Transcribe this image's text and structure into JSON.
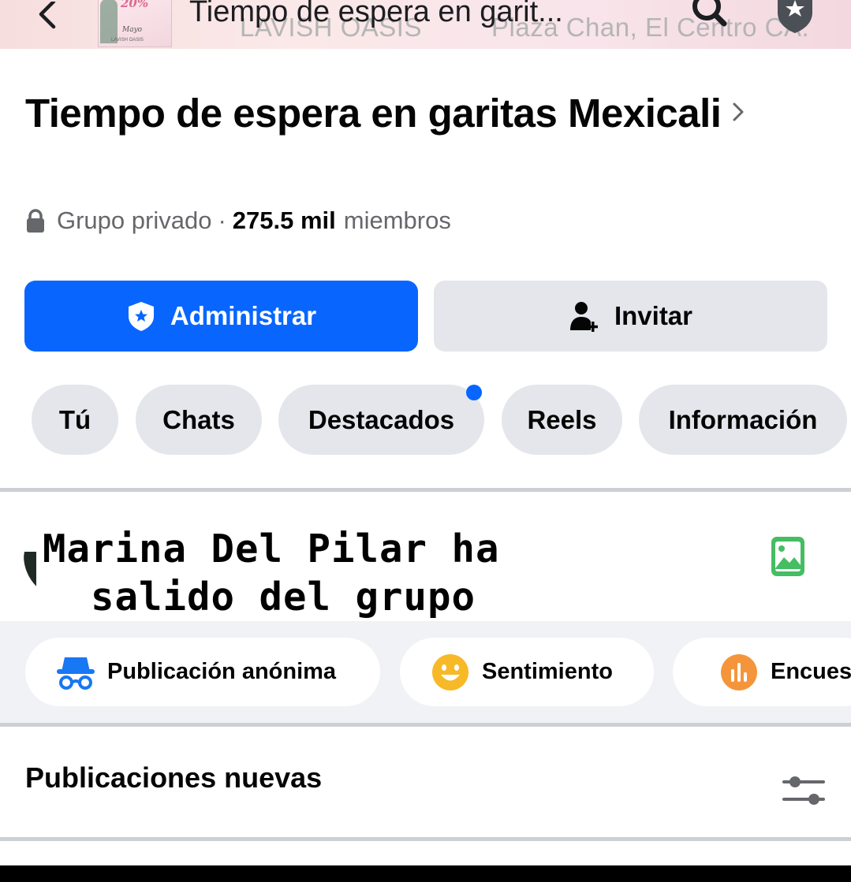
{
  "topbar": {
    "title": "Tiempo de espera en garit...",
    "cover_text_left": "LAVISH OASIS",
    "cover_text_right": "Plaza Chan, El Centro CA.",
    "thumb_percent": "20%",
    "thumb_caption": "Mayo",
    "thumb_footer": "LAVISH OASIS",
    "icons": {
      "back": "chevron-left-icon",
      "search": "search-icon",
      "star": "admin-badge-star-icon"
    },
    "background_color": "#f7dede"
  },
  "group": {
    "name": "Tiempo de espera en garitas Mexicali",
    "privacy": "Grupo privado",
    "separator": "·",
    "member_count": "275.5 mil",
    "member_label": "miembros"
  },
  "actions": {
    "manage_label": "Administrar",
    "invite_label": "Invitar",
    "accent_color": "#0866ff"
  },
  "tabs": [
    {
      "label": "Tú"
    },
    {
      "label": "Chats"
    },
    {
      "label": "Destacados",
      "has_notification_dot": true
    },
    {
      "label": "Reels"
    },
    {
      "label": "Información"
    }
  ],
  "composer": {
    "overlay_line_1": "Marina Del Pilar ha",
    "overlay_line_2": "salido del grupo",
    "photo_icon": "photo-icon",
    "photo_icon_color": "#45bd62"
  },
  "post_types": [
    {
      "label": "Publicación anónima",
      "icon": "incognito-icon"
    },
    {
      "label": "Sentimiento",
      "icon": "smiley-icon"
    },
    {
      "label": "Encues",
      "icon": "poll-icon"
    }
  ],
  "feed": {
    "section_title": "Publicaciones nuevas",
    "filter_icon": "sliders-icon"
  }
}
